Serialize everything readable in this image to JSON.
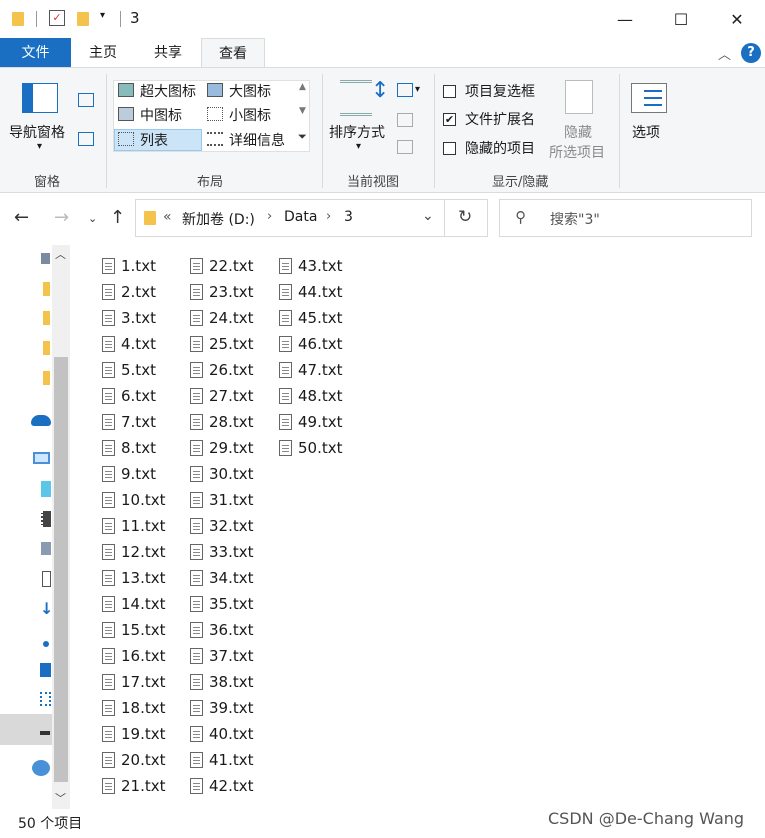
{
  "window": {
    "title": "3",
    "minimize": "—",
    "maximize": "☐",
    "close": "✕"
  },
  "tabs": {
    "file": "文件",
    "home": "主页",
    "share": "共享",
    "view": "查看"
  },
  "ribbon": {
    "pane": {
      "nav_pane": "导航窗格",
      "label": "窗格"
    },
    "layout": {
      "xlarge": "超大图标",
      "large": "大图标",
      "medium": "中图标",
      "small": "小图标",
      "list": "列表",
      "details": "详细信息",
      "label": "布局"
    },
    "view": {
      "sort": "排序方式",
      "label": "当前视图"
    },
    "show_hide": {
      "item_checkboxes": "项目复选框",
      "file_ext": "文件扩展名",
      "hidden_items": "隐藏的项目",
      "hide_line1": "隐藏",
      "hide_line2": "所选项目",
      "label": "显示/隐藏",
      "item_checkboxes_checked": false,
      "file_ext_checked": true,
      "hidden_items_checked": false
    },
    "options": "选项"
  },
  "address": {
    "path": [
      "新加卷 (D:)",
      "Data",
      "3"
    ],
    "search_placeholder": "搜索\"3\""
  },
  "files": [
    "1.txt",
    "2.txt",
    "3.txt",
    "4.txt",
    "5.txt",
    "6.txt",
    "7.txt",
    "8.txt",
    "9.txt",
    "10.txt",
    "11.txt",
    "12.txt",
    "13.txt",
    "14.txt",
    "15.txt",
    "16.txt",
    "17.txt",
    "18.txt",
    "19.txt",
    "20.txt",
    "21.txt",
    "22.txt",
    "23.txt",
    "24.txt",
    "25.txt",
    "26.txt",
    "27.txt",
    "28.txt",
    "29.txt",
    "30.txt",
    "31.txt",
    "32.txt",
    "33.txt",
    "34.txt",
    "35.txt",
    "36.txt",
    "37.txt",
    "38.txt",
    "39.txt",
    "40.txt",
    "41.txt",
    "42.txt",
    "43.txt",
    "44.txt",
    "45.txt",
    "46.txt",
    "47.txt",
    "48.txt",
    "49.txt",
    "50.txt"
  ],
  "status": {
    "count": "50 个项目"
  },
  "watermark": "CSDN @De-Chang Wang",
  "colors": {
    "accent": "#1a6fc3",
    "folder": "#f3c34b",
    "selected_layout": "#cce4f7"
  }
}
